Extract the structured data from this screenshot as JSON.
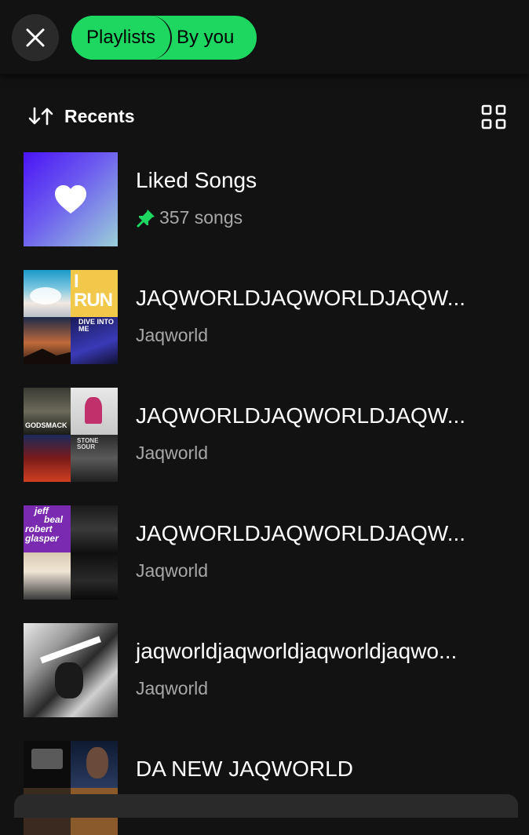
{
  "header": {
    "close_icon": "close-icon",
    "filters": {
      "playlists_label": "Playlists",
      "by_you_label": "By you"
    },
    "accent_color": "#1ed760"
  },
  "sort": {
    "icon": "sort-arrows-icon",
    "label": "Recents",
    "view_toggle_icon": "grid-view-icon"
  },
  "library": {
    "items": [
      {
        "title": "Liked Songs",
        "subtitle": "357 songs",
        "pinned": true,
        "thumb": "heart-gradient"
      },
      {
        "title": "JAQWORLDJAQWORLDJAQW...",
        "subtitle": "Jaqworld",
        "art_text": [
          "I RUN",
          "DIVE INTO ME"
        ]
      },
      {
        "title": "JAQWORLDJAQWORLDJAQW...",
        "subtitle": "Jaqworld",
        "art_text": [
          "GODSMACK",
          "STONE SOUR"
        ]
      },
      {
        "title": "JAQWORLDJAQWORLDJAQW...",
        "subtitle": "Jaqworld",
        "art_text": [
          "jeff",
          "beal",
          "robert",
          "glasper"
        ]
      },
      {
        "title": "jaqworldjaqworldjaqworldjaqwo...",
        "subtitle": "Jaqworld"
      },
      {
        "title": "DA NEW JAQWORLD",
        "subtitle": ""
      }
    ]
  }
}
